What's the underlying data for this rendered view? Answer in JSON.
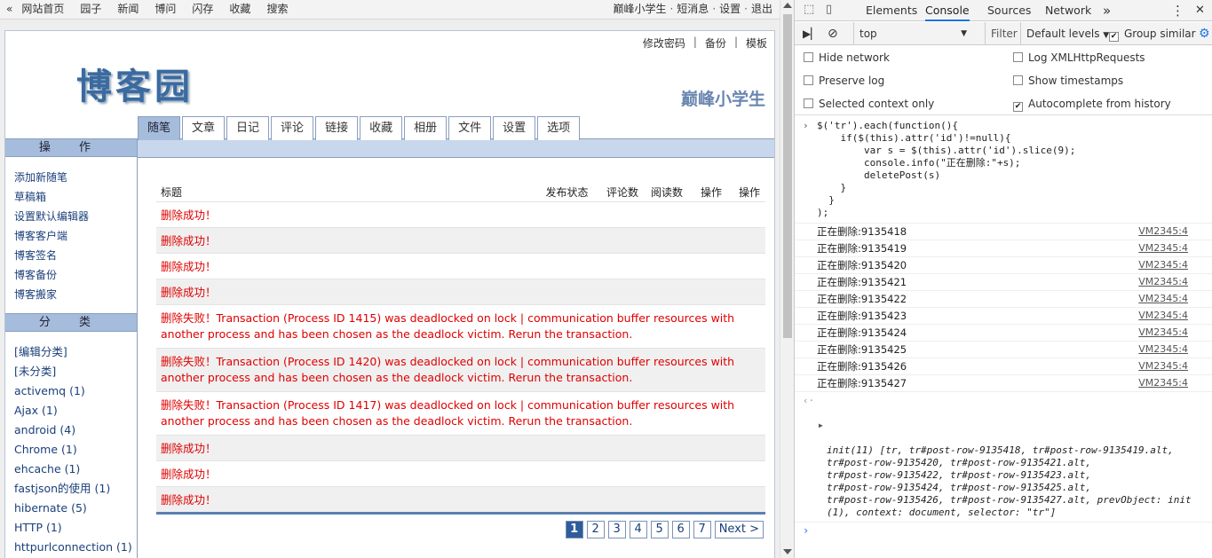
{
  "topbar": {
    "back": "«",
    "left_links": [
      "网站首页",
      "园子",
      "新闻",
      "博问",
      "闪存",
      "收藏",
      "搜索"
    ],
    "right_links": [
      "巅峰小学生",
      "短消息",
      "设置",
      "退出"
    ],
    "sep": "·"
  },
  "blog": {
    "logo": "博客园",
    "links": [
      "修改密码",
      "备份",
      "模板"
    ],
    "link_sep": "|",
    "name": "巅峰小学生",
    "tabs": [
      "随笔",
      "文章",
      "日记",
      "评论",
      "链接",
      "收藏",
      "相册",
      "文件",
      "设置",
      "选项"
    ],
    "active_tab": "随笔"
  },
  "sidebar": {
    "ops_title": "操 作",
    "ops": [
      "添加新随笔",
      "草稿箱",
      "设置默认编辑器",
      "博客客户端",
      "博客签名",
      "博客备份",
      "博客搬家"
    ],
    "cat_title": "分 类",
    "cats": [
      "[编辑分类]",
      "[未分类]",
      "activemq (1)",
      "Ajax (1)",
      "android (4)",
      "Chrome (1)",
      "ehcache (1)",
      "fastjson的使用 (1)",
      "hibernate (5)",
      "HTTP (1)",
      "httpurlconnection (1)"
    ]
  },
  "table": {
    "headers": [
      "标题",
      "发布状态",
      "评论数",
      "阅读数",
      "操作",
      "操作"
    ],
    "rows": [
      "删除成功！",
      "删除成功！",
      "删除成功！",
      "删除成功！",
      "删除失败！Transaction (Process ID 1415) was deadlocked on lock | communication buffer resources with another process and has been chosen as the deadlock victim. Rerun the transaction.",
      "删除失败！Transaction (Process ID 1420) was deadlocked on lock | communication buffer resources with another process and has been chosen as the deadlock victim. Rerun the transaction.",
      "删除失败！Transaction (Process ID 1417) was deadlocked on lock | communication buffer resources with another process and has been chosen as the deadlock victim. Rerun the transaction.",
      "删除成功！",
      "删除成功！",
      "删除成功！"
    ]
  },
  "pager": {
    "pages": [
      "1",
      "2",
      "3",
      "4",
      "5",
      "6",
      "7"
    ],
    "current": "1",
    "next": "Next >"
  },
  "devtools": {
    "tabs": [
      "Elements",
      "Console",
      "Sources",
      "Network"
    ],
    "active_tab": "Console",
    "more": "»",
    "context": "top",
    "filter_placeholder": "Filter",
    "levels": "Default levels",
    "group_similar": "Group similar",
    "options": [
      {
        "label": "Hide network",
        "checked": false
      },
      {
        "label": "Log XMLHttpRequests",
        "checked": false
      },
      {
        "label": "Preserve log",
        "checked": false
      },
      {
        "label": "Show timestamps",
        "checked": false
      },
      {
        "label": "Selected context only",
        "checked": false
      },
      {
        "label": "Autocomplete from history",
        "checked": true
      }
    ],
    "command_lines": [
      "$('tr').each(function(){",
      "    if($(this).attr('id')!=null){",
      "        var s = $(this).attr('id').slice(9);",
      "        console.info(\"正在删除:\"+s);",
      "        deletePost(s)",
      "    }",
      "  }",
      ");"
    ],
    "log_lines": [
      "正在删除:9135418",
      "正在删除:9135419",
      "正在删除:9135420",
      "正在删除:9135421",
      "正在删除:9135422",
      "正在删除:9135423",
      "正在删除:9135424",
      "正在删除:9135425",
      "正在删除:9135426",
      "正在删除:9135427"
    ],
    "log_source": "VM2345:4",
    "result_lines": [
      "init(11) [tr, tr#post-row-9135418, tr#post-row-9135419.alt,",
      "tr#post-row-9135420, tr#post-row-9135421.alt,",
      "tr#post-row-9135422, tr#post-row-9135423.alt,",
      "tr#post-row-9135424, tr#post-row-9135425.alt,",
      "tr#post-row-9135426, tr#post-row-9135427.alt, prevObject: init",
      "(1), context: document, selector: \"tr\"]"
    ],
    "accent": "#1a73e8"
  }
}
